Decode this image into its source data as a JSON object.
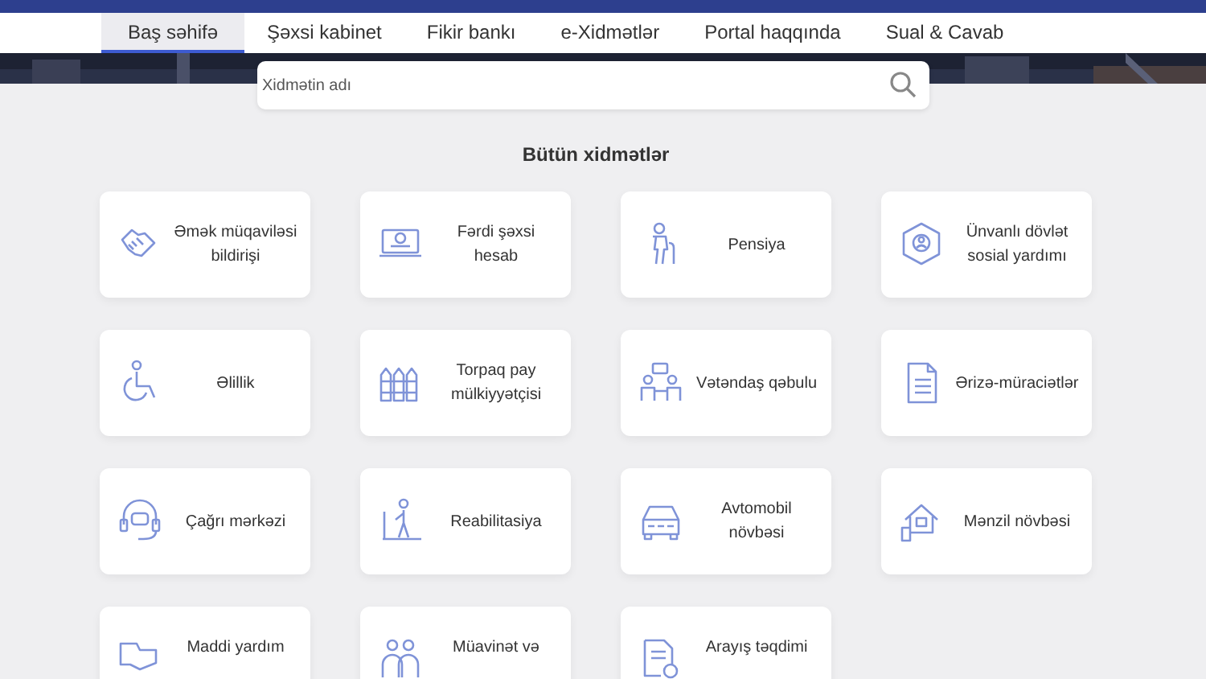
{
  "nav": {
    "tabs": [
      {
        "label": "Baş səhifə",
        "selected": true
      },
      {
        "label": "Şəxsi kabinet",
        "selected": false
      },
      {
        "label": "Fikir bankı",
        "selected": false
      },
      {
        "label": "e-Xidmətlər",
        "selected": false
      },
      {
        "label": "Portal haqqında",
        "selected": false
      },
      {
        "label": "Sual & Cavab",
        "selected": false
      }
    ]
  },
  "search": {
    "placeholder": "Xidmətin adı"
  },
  "services": {
    "title": "Bütün xidmətlər",
    "items": [
      {
        "label": "Əmək müqaviləsi bildirişi"
      },
      {
        "label": "Fərdi şəxsi hesab"
      },
      {
        "label": "Pensiya"
      },
      {
        "label": "Ünvanlı dövlət sosial yardımı"
      },
      {
        "label": "Əlillik"
      },
      {
        "label": "Torpaq pay mülkiyyətçisi"
      },
      {
        "label": "Vətəndaş qəbulu"
      },
      {
        "label": "Ərizə-müraciətlər"
      },
      {
        "label": "Çağrı mərkəzi"
      },
      {
        "label": "Reabilitasiya"
      },
      {
        "label": "Avtomobil növbəsi"
      },
      {
        "label": "Mənzil növbəsi"
      },
      {
        "label": "Maddi yardım"
      },
      {
        "label": "Müavinət və"
      },
      {
        "label": "Arayış təqdimi"
      }
    ]
  }
}
